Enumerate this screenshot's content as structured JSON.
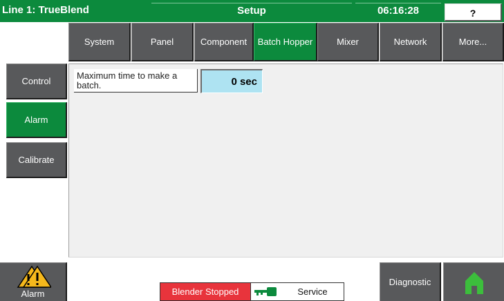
{
  "header": {
    "line_title": "Line 1: TrueBlend",
    "screen_title": "Setup",
    "clock": "06:16:28",
    "help_label": "?"
  },
  "tabs": [
    {
      "label": "System",
      "active": false
    },
    {
      "label": "Panel",
      "active": false
    },
    {
      "label": "Component",
      "active": false
    },
    {
      "label": "Batch Hopper",
      "active": true
    },
    {
      "label": "Mixer",
      "active": false
    },
    {
      "label": "Network",
      "active": false
    },
    {
      "label": "More...",
      "active": false
    }
  ],
  "sidebar": {
    "items": [
      {
        "label": "Control",
        "active": false
      },
      {
        "label": "Alarm",
        "active": true
      },
      {
        "label": "Calibrate",
        "active": false
      }
    ]
  },
  "main": {
    "field_label": "Maximum time to make a batch.",
    "field_value": "0 sec"
  },
  "footer": {
    "alarm_label": "Alarm",
    "blender_status": "Blender Stopped",
    "service_label": "Service",
    "diagnostic_label": "Diagnostic",
    "icons": [
      "warning-icon",
      "key-icon",
      "home-icon"
    ]
  },
  "colors": {
    "accent_green": "#0c8a3d",
    "button_gray": "#58595b",
    "status_red": "#e8343c",
    "value_blue": "#aee3f2",
    "warning_yellow": "#f5b81c"
  }
}
